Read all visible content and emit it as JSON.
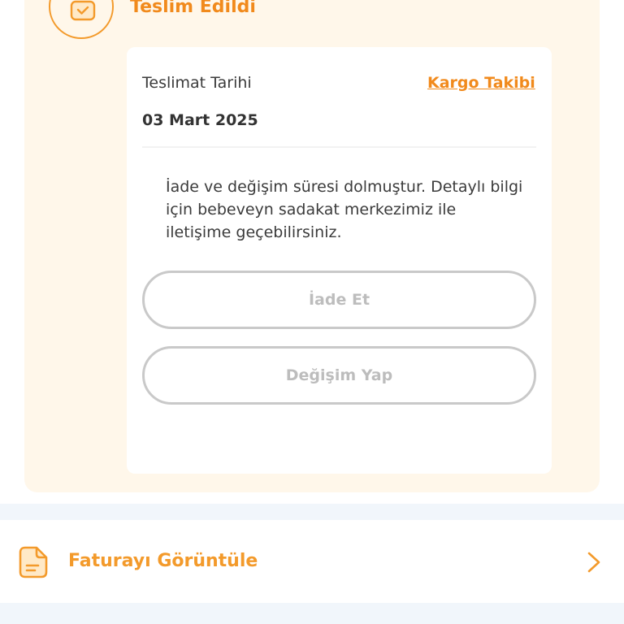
{
  "status": {
    "title": "Teslim Edildi",
    "icon": "package-check-icon",
    "accent_color": "#f18a1c"
  },
  "delivery": {
    "label": "Teslimat Tarihi",
    "date": "03 Mart 2025",
    "tracking_link": "Kargo Takibi"
  },
  "info": {
    "message": "İade ve değişim süresi dolmuştur. Detaylı bilgi için bebeveyn sadakat merkezimiz ile iletişime geçebilirsiniz."
  },
  "actions": {
    "return_label": "İade Et",
    "exchange_label": "Değişim Yap"
  },
  "invoice": {
    "label": "Faturayı Görüntüle",
    "icon": "invoice-document-icon",
    "chevron_icon": "chevron-right-icon"
  }
}
